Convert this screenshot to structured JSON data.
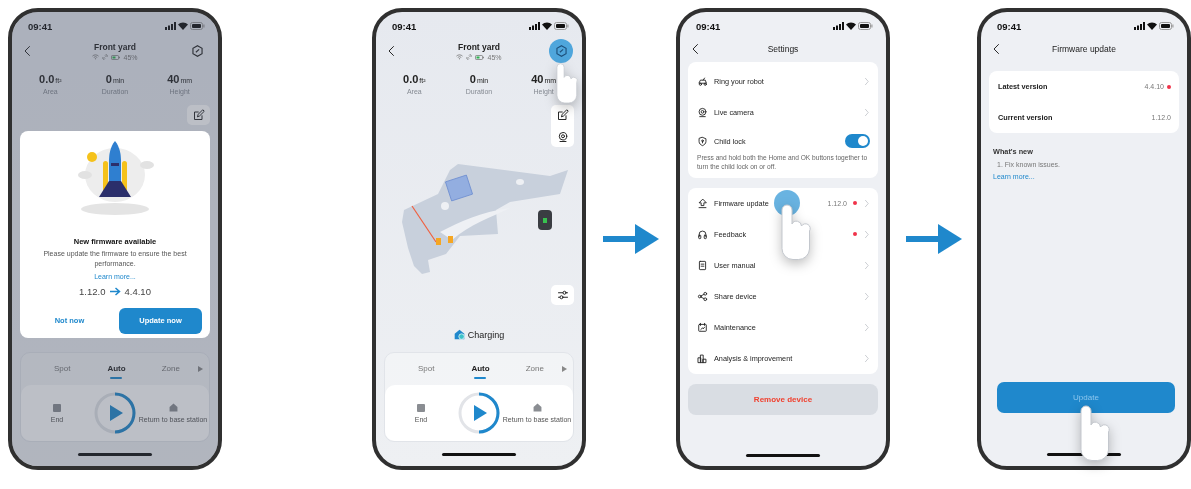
{
  "phones": [
    {
      "kind": "home",
      "dimmed": true,
      "status_bar": {
        "time": "09:41"
      },
      "header": {
        "title": "Front yard",
        "battery": "45%",
        "settings_tapped": false
      },
      "stats": [
        {
          "value": "0.0",
          "unit": "ft²",
          "label": "Area"
        },
        {
          "value": "0",
          "unit": "min",
          "label": "Duration"
        },
        {
          "value": "40",
          "unit": "mm",
          "label": "Height"
        }
      ],
      "tools": [
        {
          "kind": "edit"
        }
      ],
      "modes": [
        {
          "label": "Spot",
          "selected": false
        },
        {
          "label": "Auto",
          "selected": true
        },
        {
          "label": "Zone",
          "selected": false
        }
      ],
      "controls": {
        "end": "End",
        "return": "Return to base station"
      },
      "dialog": {
        "title": "New firmware available",
        "message": "Please update the firmware to ensure the best performance.",
        "link": "Learn more...",
        "from_version": "1.12.0",
        "to_version": "4.4.10",
        "buttons": [
          {
            "label": "Not now",
            "kind": "text"
          },
          {
            "label": "Update now",
            "kind": "primary"
          }
        ]
      }
    },
    {
      "kind": "home",
      "dimmed": false,
      "status_bar": {
        "time": "09:41"
      },
      "header": {
        "title": "Front yard",
        "battery": "45%",
        "settings_tapped": true
      },
      "stats": [
        {
          "value": "0.0",
          "unit": "ft²",
          "label": "Area"
        },
        {
          "value": "0",
          "unit": "min",
          "label": "Duration"
        },
        {
          "value": "40",
          "unit": "mm",
          "label": "Height"
        }
      ],
      "tools": [
        {
          "kind": "edit"
        },
        {
          "kind": "camera"
        }
      ],
      "side_buttons": [
        {
          "kind": "sliders"
        }
      ],
      "map": true,
      "status": "Charging",
      "modes": [
        {
          "label": "Spot",
          "selected": false
        },
        {
          "label": "Auto",
          "selected": true
        },
        {
          "label": "Zone",
          "selected": false
        }
      ],
      "controls": {
        "end": "End",
        "return": "Return to base station"
      }
    },
    {
      "kind": "settings",
      "status_bar": {
        "time": "09:41"
      },
      "title": "Settings",
      "groups": [
        {
          "items": [
            {
              "kind": "link",
              "label": "Ring your robot",
              "badge": false,
              "tapped": false
            },
            {
              "kind": "link",
              "label": "Live camera",
              "badge": false,
              "tapped": false
            },
            {
              "kind": "toggle",
              "label": "Child lock",
              "on": true,
              "note": "Press and hold both the Home and OK buttons together to turn the child lock on or off."
            }
          ]
        },
        {
          "items": [
            {
              "kind": "link",
              "label": "Firmware update",
              "value": "1.12.0",
              "badge": true,
              "tapped": true
            },
            {
              "kind": "link",
              "label": "Feedback",
              "badge": true,
              "tapped": false
            },
            {
              "kind": "link",
              "label": "User manual",
              "badge": false,
              "tapped": false
            },
            {
              "kind": "link",
              "label": "Share device",
              "badge": false,
              "tapped": false
            },
            {
              "kind": "link",
              "label": "Maintenance",
              "badge": false,
              "tapped": false
            },
            {
              "kind": "link",
              "label": "Analysis & improvement",
              "badge": false,
              "tapped": false
            }
          ]
        }
      ],
      "danger_button": "Remove device"
    },
    {
      "kind": "firmware",
      "status_bar": {
        "time": "09:41"
      },
      "title": "Firmware update",
      "versions": [
        {
          "label": "Latest version",
          "value": "4.4.10",
          "badge": true
        },
        {
          "label": "Current version",
          "value": "1.12.0",
          "badge": false
        }
      ],
      "whats_new": {
        "title": "What's new",
        "items": [
          "1. Fix known issues."
        ],
        "link": "Learn more..."
      },
      "button": {
        "label": "Update",
        "tapped": true
      }
    }
  ]
}
